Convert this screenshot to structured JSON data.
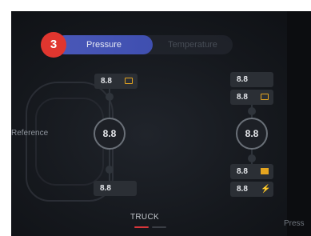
{
  "step": "3",
  "tabs": {
    "pressure": "Pressure",
    "temperature": "Temperature"
  },
  "reference_label": "Reference",
  "axles": {
    "front": {
      "top_value": "8.8",
      "hub_value": "8.8",
      "bottom_value": "8.8"
    },
    "rear": {
      "chip1": "8.8",
      "chip2": "8.8",
      "hub_value": "8.8",
      "chip3": "8.8",
      "chip4": "8.8"
    }
  },
  "vehicle_label": "TRUCK",
  "cut_label": "Press",
  "colors": {
    "accent_tab": "#4a58b8",
    "badge": "#e0362f",
    "warning": "#e5a51f",
    "page_indicator": "#d8363a"
  },
  "icons": {
    "front_top": "tire-card-warning-icon",
    "rear_chip2": "tire-card-warning-icon",
    "rear_chip3": "tire-solid-warning-icon",
    "rear_chip4": "temperature-warning-icon"
  }
}
